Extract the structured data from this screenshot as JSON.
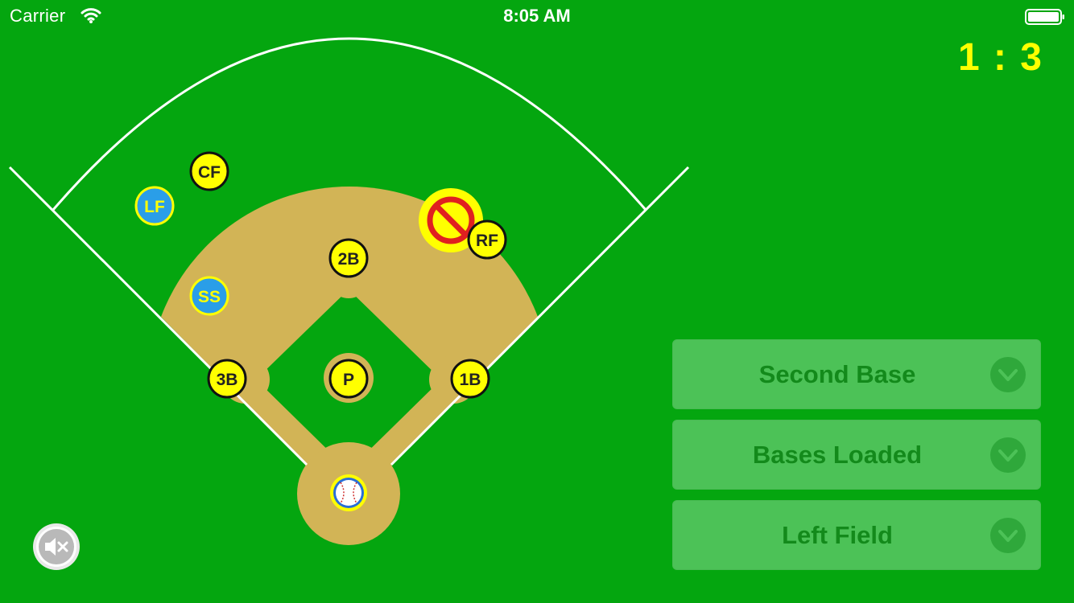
{
  "status_bar": {
    "carrier": "Carrier",
    "time": "8:05 AM"
  },
  "score": {
    "text": "1 : 3"
  },
  "field": {
    "positions": {
      "cf": "CF",
      "lf": "LF",
      "rf": "RF",
      "ss": "SS",
      "second_base": "2B",
      "third_base": "3B",
      "first_base": "1B",
      "pitcher": "P"
    },
    "no_entry_marker": "no-entry-icon"
  },
  "options": [
    {
      "label": "Second Base",
      "icon": "chevron-down-icon"
    },
    {
      "label": "Bases Loaded",
      "icon": "chevron-down-icon"
    },
    {
      "label": "Left Field",
      "icon": "chevron-down-icon"
    }
  ],
  "mute_button": {
    "icon": "speaker-muted-icon"
  },
  "colors": {
    "grass": "#04a60f",
    "infield_dirt": "#d2b456",
    "fielder_default": "#ffff00",
    "fielder_selected": "#2a9ee8",
    "score": "#ffff00",
    "option_background": "#4cc257",
    "option_text": "#138a1b",
    "no_entry_red": "#e02020"
  }
}
